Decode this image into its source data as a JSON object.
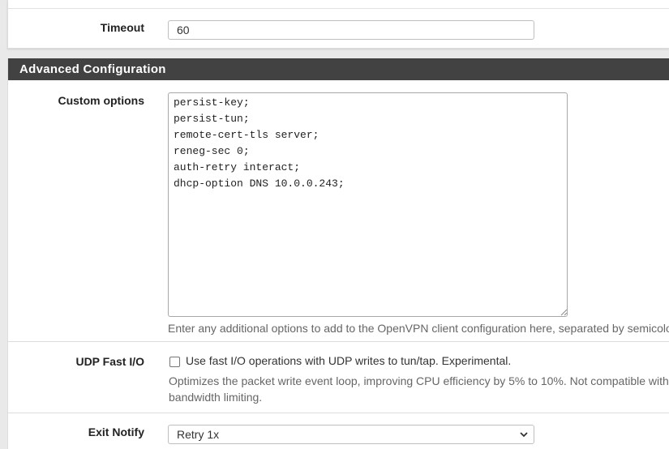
{
  "timeout": {
    "label": "Timeout",
    "value": "60"
  },
  "advanced": {
    "heading": "Advanced Configuration",
    "custom_options": {
      "label": "Custom options",
      "value": "persist-key;\npersist-tun;\nremote-cert-tls server;\nreneg-sec 0;\nauth-retry interact;\ndhcp-option DNS 10.0.0.243;",
      "help": "Enter any additional options to add to the OpenVPN client configuration here, separated by semicolo"
    },
    "udp_fast_io": {
      "label": "UDP Fast I/O",
      "checkbox_text": "Use fast I/O operations with UDP writes to tun/tap. Experimental.",
      "checked": false,
      "help_line1": "Optimizes the packet write event loop, improving CPU efficiency by 5% to 10%. Not compatible with a",
      "help_line2": "bandwidth limiting."
    },
    "exit_notify": {
      "label": "Exit Notify",
      "selected": "Retry 1x"
    }
  },
  "icons": {
    "resize": "resize-grip-icon",
    "dropdown": "chevron-down-icon"
  },
  "colors": {
    "heading_bg": "#424242",
    "heading_text": "#ffffff",
    "page_bg": "#e9e9e9"
  }
}
